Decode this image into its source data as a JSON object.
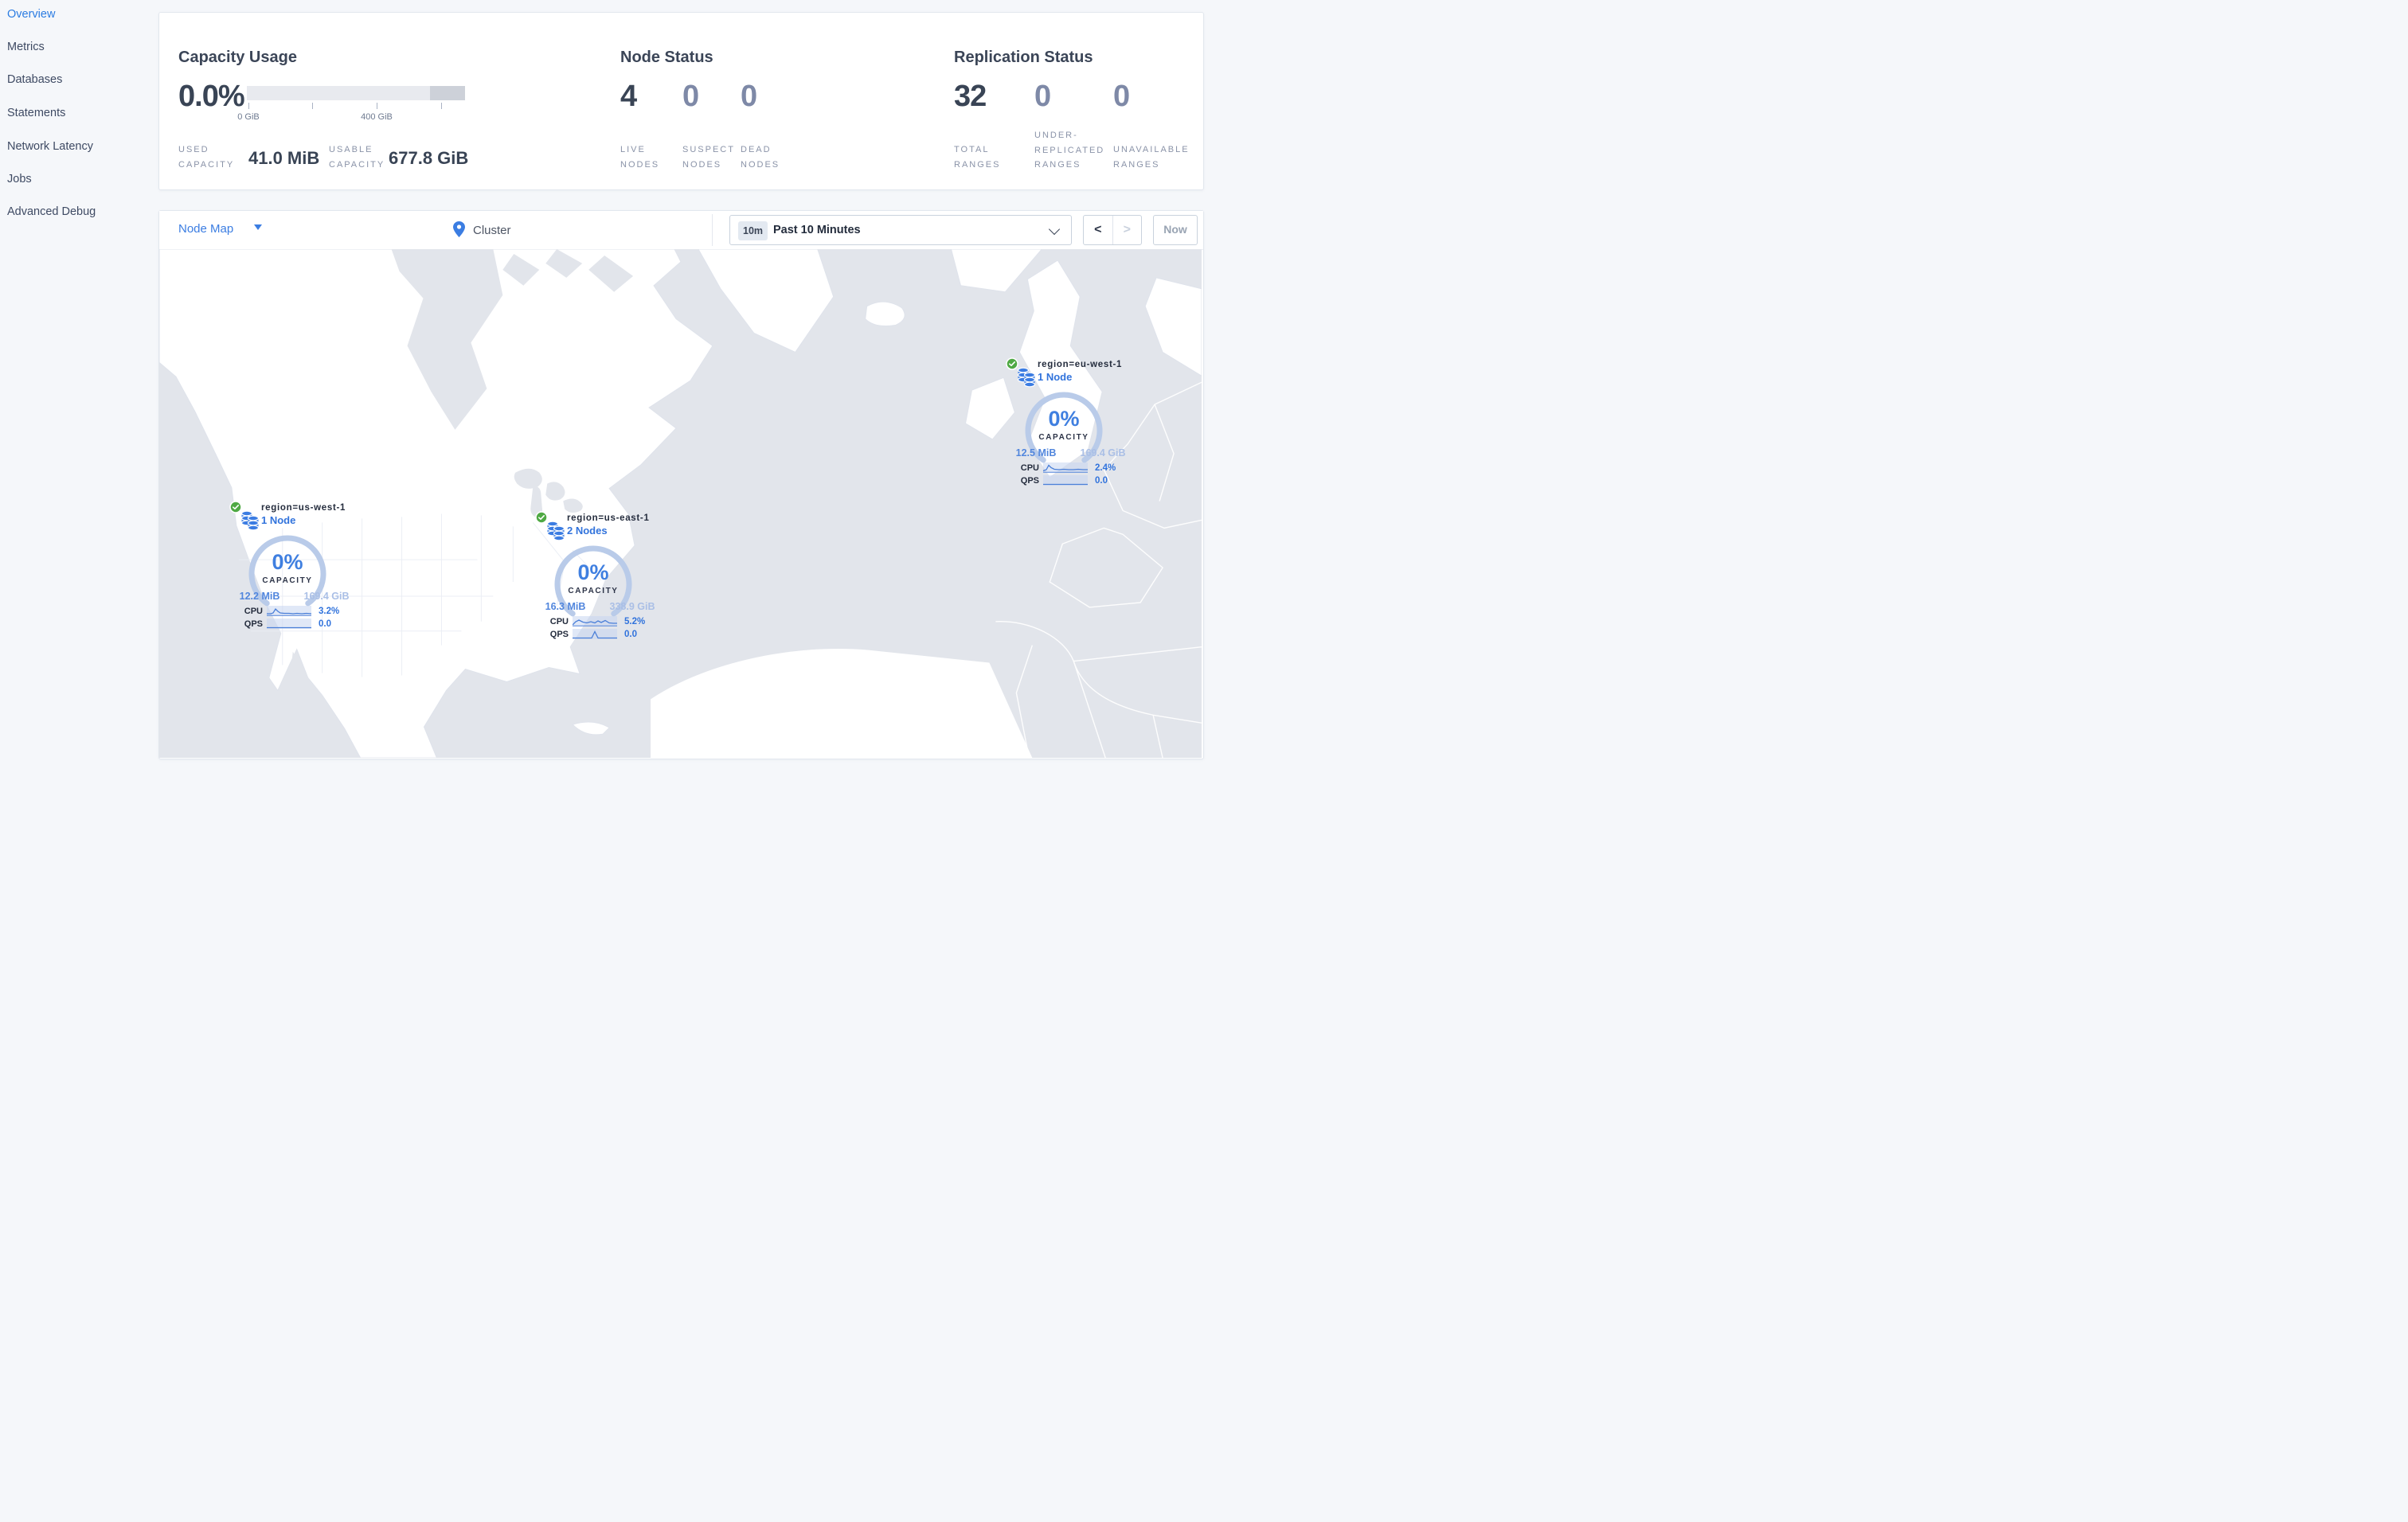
{
  "sidebar": {
    "items": [
      {
        "label": "Overview",
        "active": true
      },
      {
        "label": "Metrics",
        "active": false
      },
      {
        "label": "Databases",
        "active": false
      },
      {
        "label": "Statements",
        "active": false
      },
      {
        "label": "Network Latency",
        "active": false
      },
      {
        "label": "Jobs",
        "active": false
      },
      {
        "label": "Advanced Debug",
        "active": false
      }
    ]
  },
  "summary": {
    "capacity": {
      "title": "Capacity Usage",
      "percent": "0.0%",
      "tick_labels": [
        "0 GiB",
        "400 GiB"
      ],
      "used_label": "USED CAPACITY",
      "used_value": "41.0 MiB",
      "usable_label": "USABLE CAPACITY",
      "usable_value": "677.8 GiB"
    },
    "node_status": {
      "title": "Node Status",
      "stats": [
        {
          "value": "4",
          "label": "LIVE NODES"
        },
        {
          "value": "0",
          "label": "SUSPECT NODES"
        },
        {
          "value": "0",
          "label": "DEAD NODES"
        }
      ]
    },
    "replication": {
      "title": "Replication Status",
      "stats": [
        {
          "value": "32",
          "label": "TOTAL RANGES"
        },
        {
          "value": "0",
          "label": "UNDER-REPLICATED RANGES"
        },
        {
          "value": "0",
          "label": "UNAVAILABLE RANGES"
        }
      ]
    }
  },
  "toolbar": {
    "view_label": "Node Map",
    "breadcrumb": "Cluster",
    "time_badge": "10m",
    "time_range": "Past 10 Minutes",
    "prev_label": "<",
    "next_label": ">",
    "now_label": "Now"
  },
  "map": {
    "regions": [
      {
        "name": "us-west-1",
        "title": "region=us-west-1",
        "nodes_label": "1 Node",
        "percent": "0%",
        "capacity_label": "CAPACITY",
        "used": "12.2 MiB",
        "usable": "169.4 GiB",
        "cpu_label": "CPU",
        "cpu_value": "3.2%",
        "qps_label": "QPS",
        "qps_value": "0.0",
        "cpu_spark": "0,10 5,10 8,9 11,4 14,7 17,9 22,9.5 28,9.5 33,10 38,9.5 44,10 50,9.5 56,10",
        "qps_spark": "0,11.5 56,11.5"
      },
      {
        "name": "us-east-1",
        "title": "region=us-east-1",
        "nodes_label": "2 Nodes",
        "percent": "0%",
        "capacity_label": "CAPACITY",
        "used": "16.3 MiB",
        "usable": "338.9 GiB",
        "cpu_label": "CPU",
        "cpu_value": "5.2%",
        "qps_label": "QPS",
        "qps_value": "0.0",
        "cpu_spark": "0,11 4,7 8,5 13,7.5 18,8.5 23,7 28,8.5 32,6 36,8 41,5.5 46,8.5 51,9 56,9",
        "qps_spark": "0,11.5 20,11.5 24,11.5 28,3.5 32,11.5 56,11.5"
      },
      {
        "name": "eu-west-1",
        "title": "region=eu-west-1",
        "nodes_label": "1 Node",
        "percent": "0%",
        "capacity_label": "CAPACITY",
        "used": "12.5 MiB",
        "usable": "169.4 GiB",
        "cpu_label": "CPU",
        "cpu_value": "2.4%",
        "qps_label": "QPS",
        "qps_value": "0.0",
        "cpu_spark": "0,10.5 4,9 7,3.5 10,6.5 14,8.5 20,9 26,8.5 32,9 38,9 44,8.5 50,9 56,9",
        "qps_spark": "0,11.5 56,11.5"
      }
    ]
  },
  "colors": {
    "accent_blue": "#3b7de2",
    "link_blue": "#3173dc",
    "status_green": "#4fa944",
    "heading": "#3b4557",
    "muted_label": "#8a93a8",
    "gauge_arc": "#b9cbe9",
    "ocean": "#e2e5eb",
    "land": "#ffffff"
  }
}
